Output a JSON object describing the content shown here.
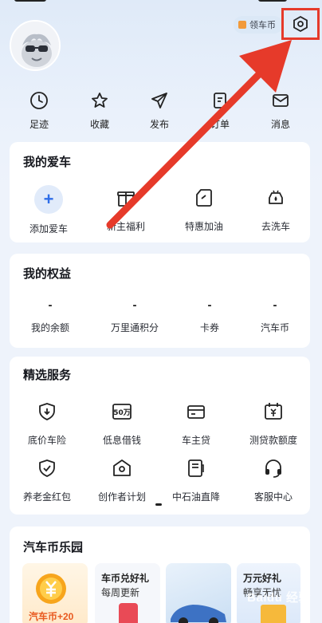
{
  "header": {
    "coin_pill_label": "领车币",
    "settings_icon": "settings-hexagon-icon"
  },
  "quick_actions": [
    {
      "label": "足迹",
      "icon": "clock-icon"
    },
    {
      "label": "收藏",
      "icon": "star-icon"
    },
    {
      "label": "发布",
      "icon": "send-icon"
    },
    {
      "label": "订单",
      "icon": "order-icon"
    },
    {
      "label": "消息",
      "icon": "mail-icon"
    }
  ],
  "my_car": {
    "title": "我的爱车",
    "items": [
      {
        "label": "添加爱车",
        "icon": "plus-icon"
      },
      {
        "label": "新主福利",
        "icon": "gift-box-icon"
      },
      {
        "label": "特惠加油",
        "icon": "fuel-can-icon"
      },
      {
        "label": "去洗车",
        "icon": "car-wash-icon"
      }
    ]
  },
  "my_rights": {
    "title": "我的权益",
    "items": [
      {
        "value": "-",
        "label": "我的余额"
      },
      {
        "value": "-",
        "label": "万里通积分"
      },
      {
        "value": "-",
        "label": "卡券"
      },
      {
        "value": "-",
        "label": "汽车币"
      }
    ]
  },
  "services": {
    "title": "精选服务",
    "items": [
      {
        "label": "底价车险",
        "icon": "shield-down-icon"
      },
      {
        "label": "低息借钱",
        "icon": "50-wan-icon",
        "icon_text": "50万"
      },
      {
        "label": "车主贷",
        "icon": "card-icon"
      },
      {
        "label": "测贷款额度",
        "icon": "calendar-yen-icon"
      },
      {
        "label": "养老金红包",
        "icon": "shield-check-icon"
      },
      {
        "label": "创作者计划",
        "icon": "creator-badge-icon"
      },
      {
        "label": "中石油直降",
        "icon": "fuel-station-icon"
      },
      {
        "label": "客服中心",
        "icon": "headset-icon"
      }
    ]
  },
  "park": {
    "title": "汽车币乐园",
    "promos": [
      {
        "line1": "",
        "line2": "汽车币+20",
        "icon": "yen-coin-icon"
      },
      {
        "line1": "车币兑好礼",
        "line2": "每周更新"
      },
      {
        "line1": "",
        "line2": ""
      },
      {
        "line1": "万元好礼",
        "line2": "畅享无忧"
      }
    ]
  },
  "watermark": "Baidu 经验",
  "colors": {
    "accent_blue": "#2f6ee8",
    "annotation_red": "#e63a2a",
    "coin_orange": "#f7a51c"
  }
}
